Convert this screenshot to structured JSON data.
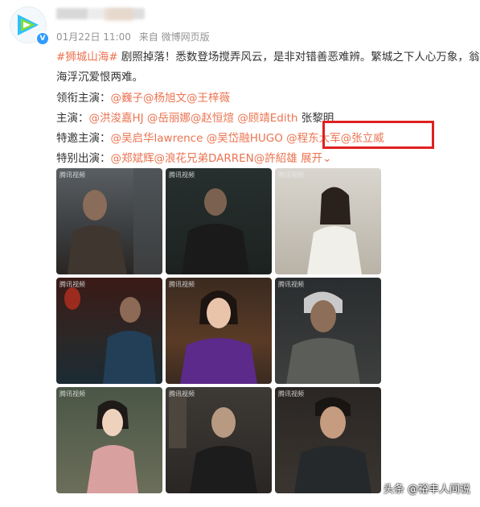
{
  "post": {
    "username": "",
    "timestamp": "01月22日 11:00",
    "source": "来自 微博网页版",
    "lines": [
      [
        {
          "t": "#狮城山海#",
          "link": true
        },
        {
          "t": " 剧照掉落！悉数登场搅弄风云，是非对错善恶难辨。繁城之下人心万象，翁",
          "link": false
        }
      ],
      [
        {
          "t": "海浮沉爱恨两难。",
          "link": false
        }
      ],
      [
        {
          "t": "领衔主演：",
          "link": false
        },
        {
          "t": "@巍子@杨旭文@王梓薇",
          "link": true
        }
      ],
      [
        {
          "t": "主演：",
          "link": false
        },
        {
          "t": "@洪浚嘉HJ @岳丽娜@赵恒煊 @顾靖Edith",
          "link": true
        },
        {
          "t": " 张黎明",
          "link": false
        }
      ],
      [
        {
          "t": "特邀主演：",
          "link": false
        },
        {
          "t": "@吴启华lawrence @吴岱融HUGO @程东大军@张立威",
          "link": true
        }
      ],
      [
        {
          "t": "特别出演：",
          "link": false
        },
        {
          "t": "@郑斌辉@浪花兄弟DARREN@許紹雄",
          "link": true
        },
        {
          "t": " 展开",
          "link": true
        }
      ]
    ],
    "photo_tag": "腾讯视频",
    "photo_count": 9
  },
  "watermark": "头条 @裕丰人间说",
  "colors": {
    "link": "#eb7350",
    "text": "#333333",
    "meta": "#939393",
    "highlight": "#e02020",
    "brand": "#1fb0e6"
  },
  "icons": {
    "avatar": "tencent-video-logo",
    "verified": "blue-v-badge",
    "expand": "chevron-down-icon"
  }
}
